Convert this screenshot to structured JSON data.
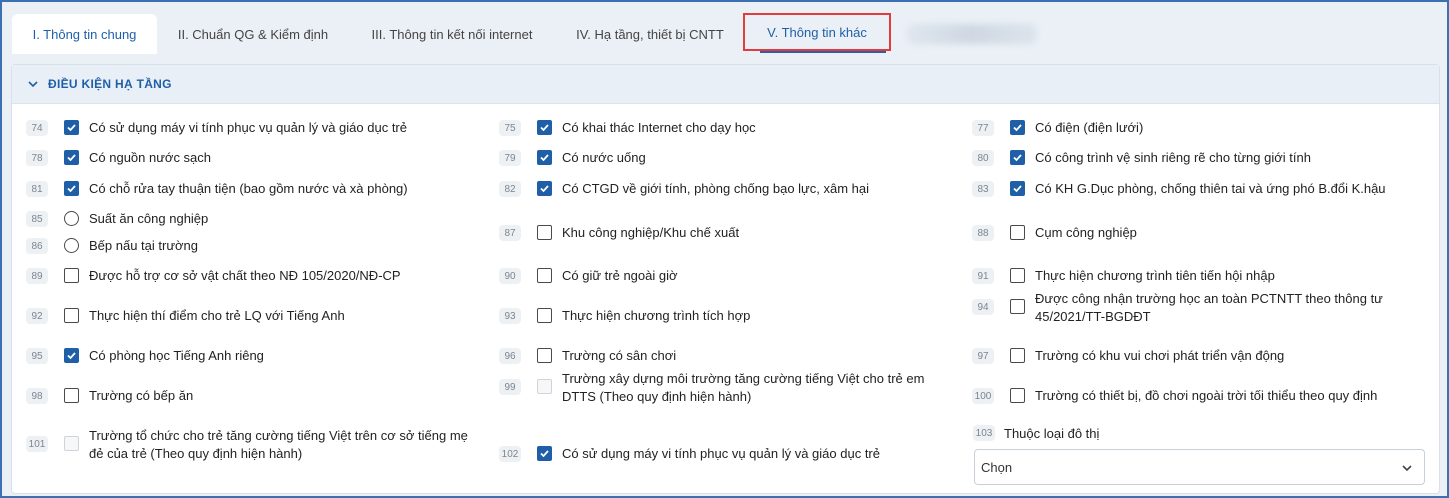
{
  "tabs": [
    {
      "label": "I. Thông tin chung"
    },
    {
      "label": "II. Chuẩn QG & Kiểm định"
    },
    {
      "label": "III. Thông tin kết nối internet"
    },
    {
      "label": "IV. Hạ tầng, thiết bị CNTT"
    },
    {
      "label": "V. Thông tin khác"
    }
  ],
  "section": {
    "title": "ĐIỀU KIỆN HẠ TẦNG"
  },
  "items": [
    {
      "num": "74",
      "label": "Có sử dụng máy vi tính phục vụ quản lý và giáo dục trẻ",
      "type": "checkbox",
      "checked": true
    },
    {
      "num": "75",
      "label": "Có khai thác Internet cho dạy học",
      "type": "checkbox",
      "checked": true
    },
    {
      "num": "77",
      "label": "Có điện (điện lưới)",
      "type": "checkbox",
      "checked": true
    },
    {
      "num": "78",
      "label": "Có nguồn nước sạch",
      "type": "checkbox",
      "checked": true
    },
    {
      "num": "79",
      "label": "Có nước uống",
      "type": "checkbox",
      "checked": true
    },
    {
      "num": "80",
      "label": "Có công trình vệ sinh riêng rẽ cho từng giới tính",
      "type": "checkbox",
      "checked": true
    },
    {
      "num": "81",
      "label": "Có chỗ rửa tay thuận tiện (bao gồm nước và xà phòng)",
      "type": "checkbox",
      "checked": true
    },
    {
      "num": "82",
      "label": "Có CTGD về giới tính, phòng chống bạo lực, xâm hại",
      "type": "checkbox",
      "checked": true
    },
    {
      "num": "83",
      "label": "Có KH G.Dục phòng, chống thiên tai và ứng phó B.đổi K.hậu",
      "type": "checkbox",
      "checked": true
    },
    {
      "num": "85",
      "label": "Suất ăn công nghiệp",
      "type": "radio",
      "checked": false
    },
    {
      "num": "86",
      "label": "Bếp nấu tại trường",
      "type": "radio",
      "checked": false
    },
    {
      "num": "87",
      "label": "Khu công nghiệp/Khu chế xuất",
      "type": "checkbox",
      "checked": false
    },
    {
      "num": "88",
      "label": "Cụm công nghiệp",
      "type": "checkbox",
      "checked": false
    },
    {
      "num": "89",
      "label": "Được hỗ trợ cơ sở vật chất theo NĐ 105/2020/NĐ-CP",
      "type": "checkbox",
      "checked": false
    },
    {
      "num": "90",
      "label": "Có giữ trẻ ngoài giờ",
      "type": "checkbox",
      "checked": false
    },
    {
      "num": "91",
      "label": "Thực hiện chương trình tiên tiến hội nhập",
      "type": "checkbox",
      "checked": false
    },
    {
      "num": "92",
      "label": "Thực hiện thí điểm cho trẻ LQ với Tiếng Anh",
      "type": "checkbox",
      "checked": false
    },
    {
      "num": "93",
      "label": "Thực hiện chương trình tích hợp",
      "type": "checkbox",
      "checked": false
    },
    {
      "num": "94",
      "label": "Được công nhận trường học an toàn PCTNTT theo thông tư 45/2021/TT-BGDĐT",
      "type": "checkbox",
      "checked": false
    },
    {
      "num": "95",
      "label": "Có phòng học Tiếng Anh riêng",
      "type": "checkbox",
      "checked": true
    },
    {
      "num": "96",
      "label": "Trường có sân chơi",
      "type": "checkbox",
      "checked": false
    },
    {
      "num": "97",
      "label": "Trường có khu vui chơi phát triển vận động",
      "type": "checkbox",
      "checked": false
    },
    {
      "num": "98",
      "label": "Trường có bếp ăn",
      "type": "checkbox",
      "checked": false
    },
    {
      "num": "99",
      "label": "Trường xây dựng môi trường tăng cường tiếng Việt cho trẻ em DTTS (Theo quy định hiện hành)",
      "type": "checkbox",
      "checked": false,
      "disabled": true
    },
    {
      "num": "100",
      "label": "Trường có thiết bị, đồ chơi ngoài trời tối thiểu theo quy định",
      "type": "checkbox",
      "checked": false
    },
    {
      "num": "101",
      "label": "Trường tổ chức cho trẻ tăng cường tiếng Việt trên cơ sở tiếng mẹ đẻ của trẻ (Theo quy định hiện hành)",
      "type": "checkbox",
      "checked": false,
      "disabled": true
    },
    {
      "num": "102",
      "label": "Có sử dụng máy vi tính phục vụ quản lý và giáo dục trẻ",
      "type": "checkbox",
      "checked": true
    }
  ],
  "urban": {
    "num": "103",
    "label": "Thuộc loại đô thị",
    "value": "Chọn"
  },
  "colors": {
    "accent": "#1f5fa8",
    "highlight": "#e23b3b",
    "frame": "#3d6fb3"
  }
}
